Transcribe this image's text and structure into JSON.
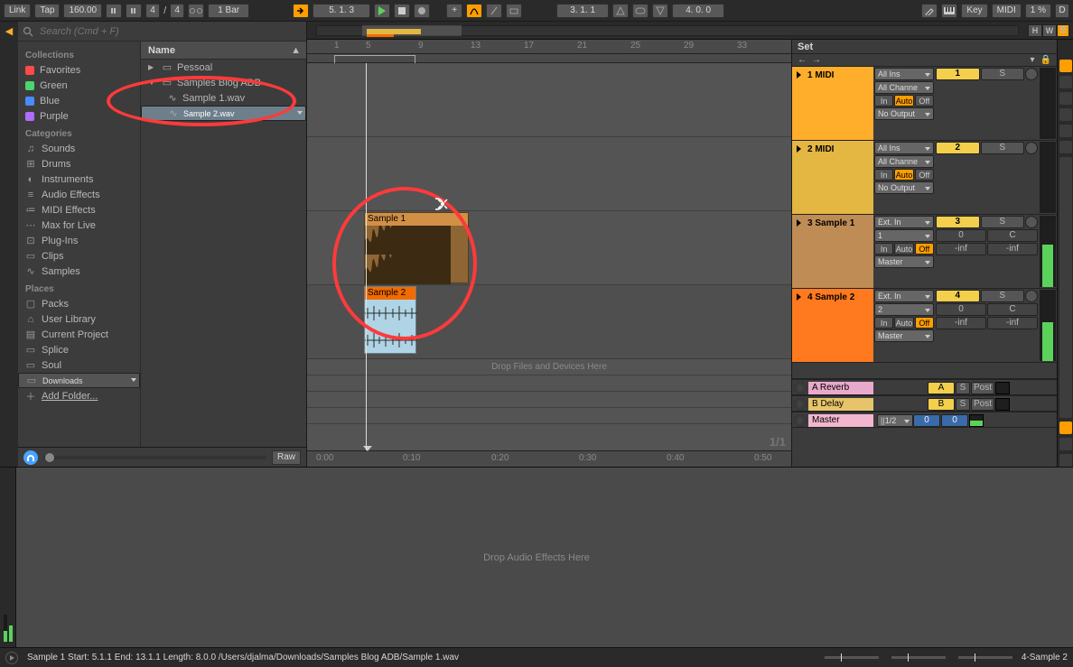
{
  "topbar": {
    "link": "Link",
    "tap": "Tap",
    "tempo": "160.00",
    "sig_num": "4",
    "sig_den": "4",
    "bar_menu": "1 Bar",
    "pos": "5.  1.  3",
    "loop": "3.  1.  1",
    "punch": "4.  0.  0",
    "key": "Key",
    "midi": "MIDI",
    "cpu": "1 %",
    "disk": "D"
  },
  "browser": {
    "search_ph": "Search (Cmd + F)",
    "collections_h": "Collections",
    "collections": [
      {
        "label": "Favorites",
        "color": "#FF4A4A"
      },
      {
        "label": "Green",
        "color": "#4AD66D"
      },
      {
        "label": "Blue",
        "color": "#4A8BFF"
      },
      {
        "label": "Purple",
        "color": "#B06CFF"
      }
    ],
    "categories_h": "Categories",
    "categories": [
      "Sounds",
      "Drums",
      "Instruments",
      "Audio Effects",
      "MIDI Effects",
      "Max for Live",
      "Plug-Ins",
      "Clips",
      "Samples"
    ],
    "places_h": "Places",
    "places": [
      "Packs",
      "User Library",
      "Current Project",
      "Splice",
      "Soul",
      "Downloads",
      "Add Folder..."
    ],
    "places_sel": 5,
    "name_h": "Name",
    "tree": [
      {
        "label": "Pessoal",
        "icon": "folder",
        "depth": 0,
        "expander": "▶"
      },
      {
        "label": "Samples Blog ADB",
        "icon": "folder",
        "depth": 0,
        "expander": "▼"
      },
      {
        "label": "Sample 1.wav",
        "icon": "wave",
        "depth": 1,
        "expander": ""
      },
      {
        "label": "Sample 2.wav",
        "icon": "wave",
        "depth": 1,
        "expander": "",
        "sel": true
      }
    ],
    "raw": "Raw"
  },
  "arrange": {
    "overview_hw": [
      "H",
      "W"
    ],
    "bars": [
      "1",
      "5",
      "9",
      "13",
      "17",
      "21",
      "25",
      "29",
      "33"
    ],
    "set": "Set",
    "drop_tracks": "Drop Files and Devices Here",
    "zoom": "1/1",
    "time": [
      "0:00",
      "0:10",
      "0:20",
      "0:30",
      "0:40",
      "0:50"
    ],
    "clips": [
      {
        "name": "Sample 1",
        "color": "#D19045",
        "wave_color": "#3C2A12"
      },
      {
        "name": "Sample 2",
        "color": "#F26B00",
        "body": "#AFD4E6",
        "wave_color": "#2B2B2B"
      }
    ]
  },
  "tracks": [
    {
      "name": "1 MIDI",
      "color": "#FFAE2B",
      "io": {
        "in1": "All Ins",
        "in2": "All Channe",
        "mon": [
          "In",
          "Auto",
          "Off"
        ],
        "mon_on": 1,
        "out": "No Output"
      },
      "mix": {
        "num": "1",
        "num_on": true,
        "s": "S",
        "rec": true
      }
    },
    {
      "name": "2 MIDI",
      "color": "#E4B642",
      "io": {
        "in1": "All Ins",
        "in2": "All Channe",
        "mon": [
          "In",
          "Auto",
          "Off"
        ],
        "mon_on": 1,
        "out": "No Output"
      },
      "mix": {
        "num": "2",
        "num_on": true,
        "s": "S",
        "rec": true
      }
    },
    {
      "name": "3 Sample 1",
      "color": "#BF8C55",
      "io": {
        "in1": "Ext. In",
        "in2": "1",
        "mon": [
          "In",
          "Auto",
          "Off"
        ],
        "mon_on": 2,
        "out": "Master"
      },
      "mix": {
        "num": "3",
        "num_on": true,
        "s": "S",
        "rec": true,
        "vol": "0",
        "pan": "C",
        "sends": [
          "-inf",
          "-inf"
        ]
      }
    },
    {
      "name": "4 Sample 2",
      "color": "#FF7A1F",
      "io": {
        "in1": "Ext. In",
        "in2": "2",
        "mon": [
          "In",
          "Auto",
          "Off"
        ],
        "mon_on": 2,
        "out": "Master",
        "mon_hl": true
      },
      "mix": {
        "num": "4",
        "num_on": true,
        "s": "S",
        "rec": true,
        "vol": "0",
        "pan": "C",
        "sends": [
          "-inf",
          "-inf"
        ]
      }
    }
  ],
  "returns": [
    {
      "name": "A Reverb",
      "color": "#E9A9CB",
      "btn": "A",
      "s": "S",
      "post": "Post"
    },
    {
      "name": "B Delay",
      "color": "#E7C46B",
      "btn": "B",
      "s": "S",
      "post": "Post"
    }
  ],
  "master": {
    "name": "Master",
    "color": "#F2B6CF",
    "sel": "1/2",
    "v1": "0",
    "v2": "0"
  },
  "devview": {
    "msg": "Drop Audio Effects Here"
  },
  "status": {
    "text": "Sample 1  Start: 5.1.1  End: 13.1.1  Length: 8.0.0  /Users/djalma/Downloads/Samples Blog ADB/Sample 1.wav",
    "track": "4-Sample 2"
  }
}
